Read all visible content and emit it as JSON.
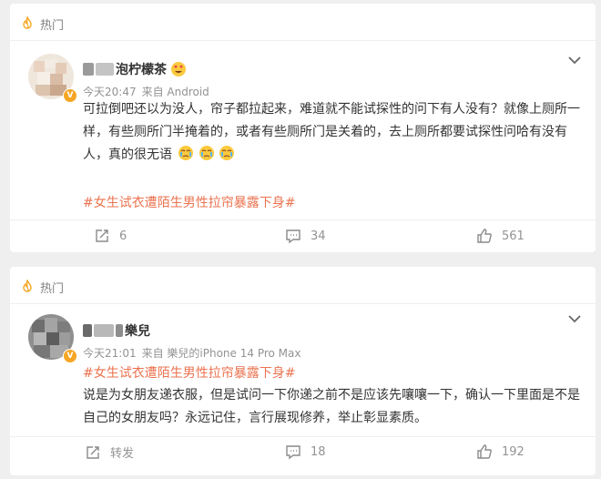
{
  "colors": {
    "hashtag": "#eb7350",
    "meta": "#939393",
    "hot_flame": "#f5a623"
  },
  "posts": [
    {
      "hot_label": "热门",
      "icons": {
        "hot": "flame-icon",
        "menu": "chevron-down-icon",
        "verified": "verified-badge-icon",
        "emoji": "heart-eyes-emoji"
      },
      "user_name": "泡柠檬茶",
      "time": "今天20:47",
      "source": "来自 Android",
      "text_lines": [
        "可拉倒吧还以为没人，帘子都拉起来，难道就不能试探性的问下有人没有？就像上厕所一",
        "样，有些厕所门半掩着的，或者有些厕所门是关着的，去上厕所都要试探性问哈有没有",
        "人，真的很无语"
      ],
      "emoji_count_note": "crying-face-emoji",
      "hashtag": "#女生试衣遭陌生男性拉帘暴露下身#",
      "actions": {
        "repost": "6",
        "comment": "34",
        "like": "561"
      }
    },
    {
      "hot_label": "热门",
      "user_name": "樂兒",
      "time": "今天21:01",
      "source": "来自 樂兒的iPhone 14 Pro Max",
      "hashtag": "#女生试衣遭陌生男性拉帘暴露下身#",
      "text_lines": [
        "说是为女朋友递衣服，但是试问一下你递之前不是应该先嚷嚷一下，确认一下里面是不是",
        "自己的女朋友吗？永远记住，言行展现修养，举止彰显素质。"
      ],
      "actions": {
        "repost": "转发",
        "comment": "18",
        "like": "192"
      }
    }
  ]
}
